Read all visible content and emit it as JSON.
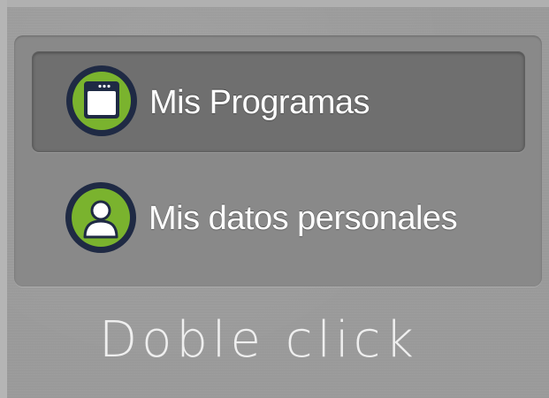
{
  "menu": {
    "items": [
      {
        "label": "Mis Programas",
        "icon": "window-app-icon",
        "selected": true
      },
      {
        "label": "Mis datos personales",
        "icon": "user-profile-icon",
        "selected": false
      }
    ]
  },
  "caption": "Doble click",
  "colors": {
    "icon_ring": "#1f2a44",
    "icon_fill": "#7ab32e",
    "label_text": "#ffffff",
    "selected_bg": "#6f6f6f"
  }
}
